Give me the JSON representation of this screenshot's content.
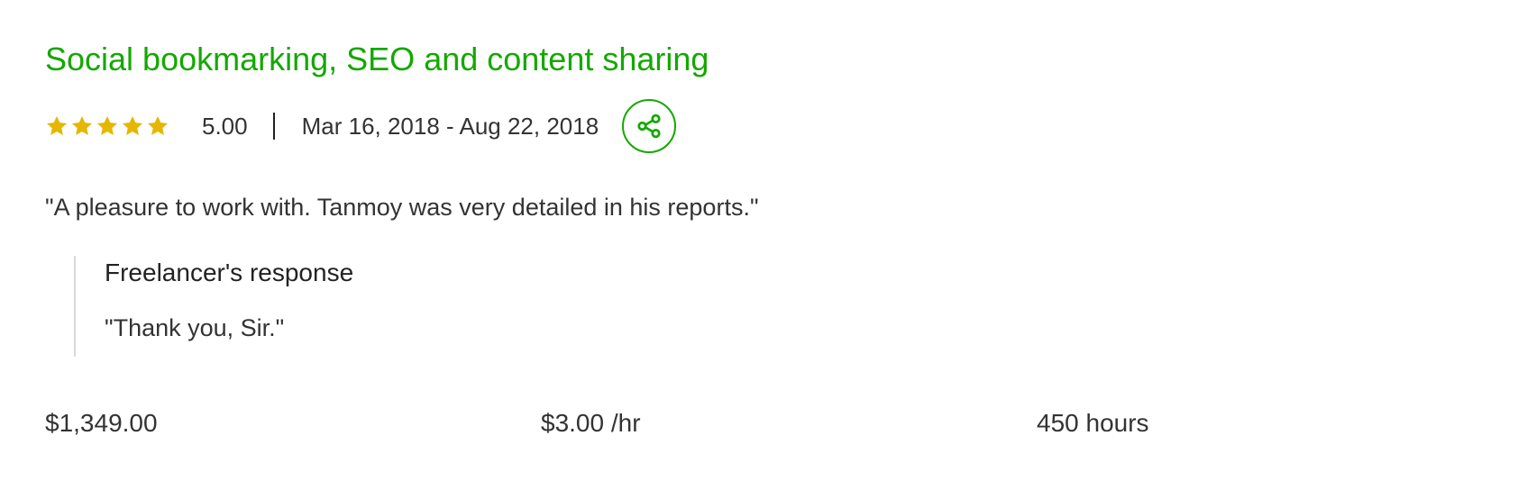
{
  "review": {
    "title": "Social bookmarking, SEO and content sharing",
    "rating": 5,
    "rating_label": "5.00",
    "star_count": 5,
    "star_color": "#e5b700",
    "dates": "Mar 16, 2018 - Aug 22, 2018",
    "share_icon": "share-icon",
    "quote": "\"A pleasure to work with. Tanmoy was very detailed in his reports.\"",
    "response": {
      "heading": "Freelancer's response",
      "text": "\"Thank you, Sir.\""
    },
    "stats": {
      "total_earned": "$1,349.00",
      "hourly_rate": "$3.00 /hr",
      "hours": "450 hours"
    }
  },
  "colors": {
    "accent": "#14a800",
    "text": "#222222",
    "divider": "#d9d9d9"
  }
}
